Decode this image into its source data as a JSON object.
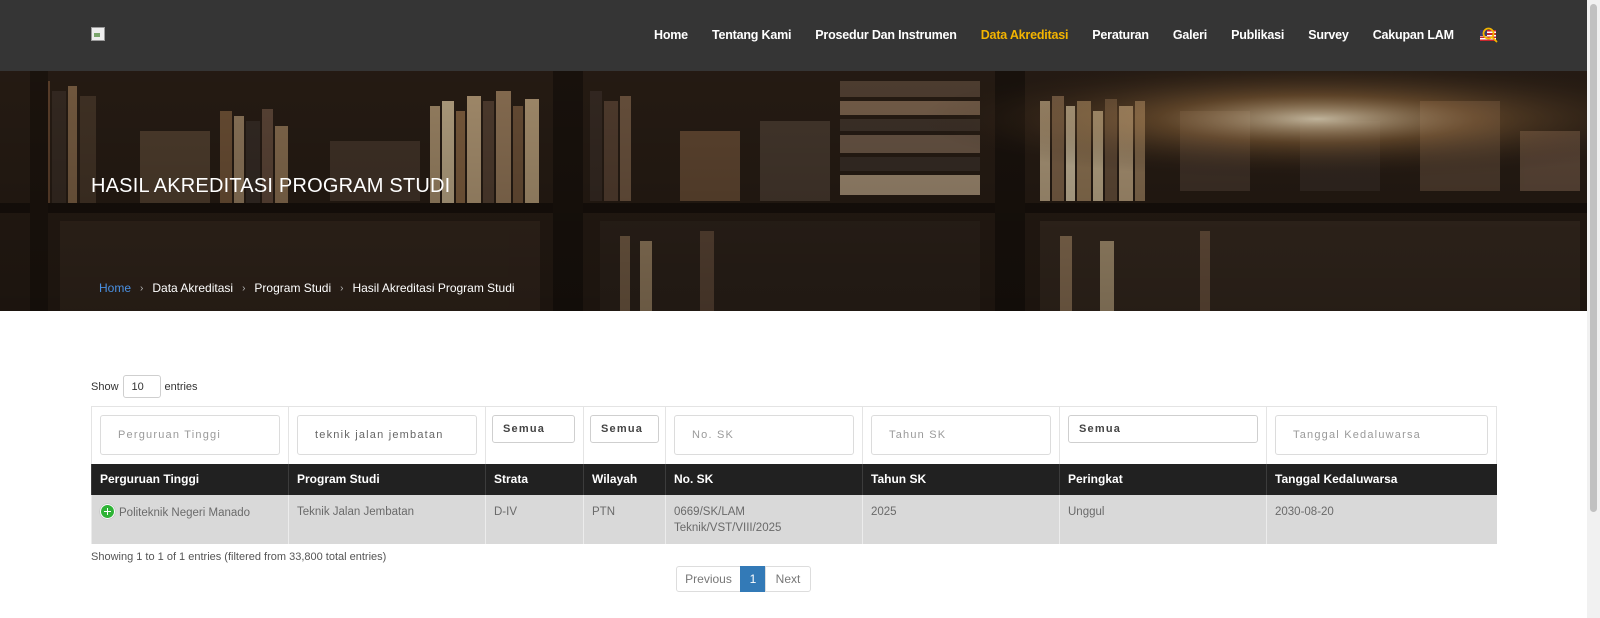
{
  "nav": {
    "items": [
      {
        "label": "Home"
      },
      {
        "label": "Tentang Kami"
      },
      {
        "label": "Prosedur Dan Instrumen"
      },
      {
        "label": "Data Akreditasi",
        "active": true
      },
      {
        "label": "Peraturan"
      },
      {
        "label": "Galeri"
      },
      {
        "label": "Publikasi"
      },
      {
        "label": "Survey"
      },
      {
        "label": "Cakupan LAM"
      }
    ],
    "flag_icon": "us-flag-icon",
    "search_icon": "search-icon",
    "active_color": "#f4b400"
  },
  "hero": {
    "title": "HASIL AKREDITASI PROGRAM STUDI",
    "breadcrumb": [
      "Home",
      "Data Akreditasi",
      "Program Studi",
      "Hasil Akreditasi Program Studi"
    ]
  },
  "controls": {
    "show_label": "Show",
    "show_value": "10",
    "entries_label": "entries"
  },
  "filters": {
    "perguruan_tinggi": "Perguruan Tinggi",
    "program_studi": "teknik jalan jembatan",
    "strata": "Semua",
    "wilayah": "Semua",
    "no_sk": "No. SK",
    "tahun_sk": "Tahun SK",
    "peringkat": "Semua",
    "tanggal": "Tanggal Kedaluwarsa"
  },
  "table": {
    "columns": [
      "Perguruan Tinggi",
      "Program Studi",
      "Strata",
      "Wilayah",
      "No. SK",
      "Tahun SK",
      "Peringkat",
      "Tanggal Kedaluwarsa"
    ],
    "rows": [
      [
        "Politeknik Negeri Manado",
        "Teknik Jalan Jembatan",
        "D-IV",
        "PTN",
        "0669/SK/LAM Teknik/VST/VIII/2025",
        "2025",
        "Unggul",
        "2030-08-20"
      ]
    ]
  },
  "info": "Showing 1 to 1 of 1 entries (filtered from 33,800 total entries)",
  "pagination": {
    "previous": "Previous",
    "page": "1",
    "next": "Next"
  }
}
